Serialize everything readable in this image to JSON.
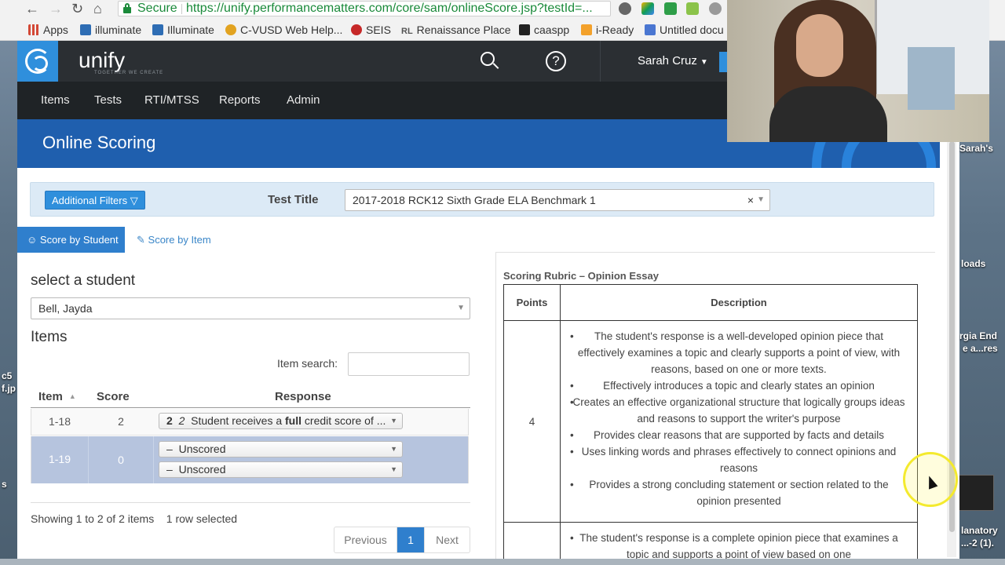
{
  "browser": {
    "secure_label": "Secure",
    "url": "https://unify.performancematters.com/core/sam/onlineScore.jsp?testId=...",
    "bookmarks": [
      {
        "label": "Apps",
        "color": "#d34836"
      },
      {
        "label": "illuminate",
        "color": "#2e6db4"
      },
      {
        "label": "Illuminate",
        "color": "#2e6db4"
      },
      {
        "label": "C-VUSD Web Help...",
        "color": "#e2a320"
      },
      {
        "label": "SEIS",
        "color": "#c62828"
      },
      {
        "label": "Renaissance Place",
        "color": "#555555"
      },
      {
        "label": "caaspp",
        "color": "#222222"
      },
      {
        "label": "i-Ready",
        "color": "#f3a12b"
      },
      {
        "label": "Untitled docu",
        "color": "#4a76d1"
      }
    ],
    "bookmark_prefix_rl": "RL"
  },
  "header": {
    "brand": "unify",
    "brand_tag": "TOGETHER WE CREATE",
    "user_name": "Sarah Cruz"
  },
  "nav": {
    "items": [
      "Items",
      "Tests",
      "RTI/MTSS",
      "Reports",
      "Admin"
    ]
  },
  "page_title": "Online Scoring",
  "filters": {
    "additional_filters_label": "Additional Filters",
    "test_title_label": "Test Title",
    "test_title_value": "2017-2018 RCK12 Sixth Grade ELA Benchmark 1",
    "clear_glyph": "×"
  },
  "tabs": {
    "score_by_student": "Score by Student",
    "score_by_item": "Score by Item"
  },
  "student": {
    "select_label": "select a student",
    "selected": "Bell, Jayda"
  },
  "items": {
    "heading": "Items",
    "search_label": "Item search:",
    "search_value": "",
    "columns": {
      "item": "Item",
      "score": "Score",
      "response": "Response"
    },
    "rows": [
      {
        "item": "1-18",
        "score": "2",
        "responses": [
          {
            "code": "2",
            "italic_code": "2",
            "text_before": "Student receives a ",
            "bold": "full",
            "text_after": " credit score of ..."
          }
        ],
        "selected": false
      },
      {
        "item": "1-19",
        "score": "0",
        "responses": [
          {
            "dash": "–",
            "text": "Unscored"
          },
          {
            "dash": "–",
            "text": "Unscored"
          }
        ],
        "selected": true
      }
    ],
    "showing": "Showing 1 to 2 of 2 items",
    "row_selected": "1 row selected",
    "pager": {
      "previous": "Previous",
      "current": "1",
      "next": "Next"
    }
  },
  "rubric": {
    "title": "Scoring Rubric – Opinion Essay",
    "col_points": "Points",
    "col_description": "Description",
    "rows": [
      {
        "points": "4",
        "bullets": [
          "The student's response is a well-developed opinion piece that effectively examines a topic and clearly supports a point of view, with reasons, based on one or more texts.",
          "Effectively introduces a topic and clearly states an opinion",
          "Creates an effective organizational structure that logically groups ideas and reasons to support the writer's purpose",
          "Provides clear reasons that are supported by facts and details",
          "Uses linking words and phrases effectively to connect opinions and reasons",
          "Provides a strong concluding statement or section related to the opinion presented"
        ]
      },
      {
        "points": "",
        "bullets": [
          "The student's response is a complete opinion piece that examines a topic and supports a point of view based on one"
        ]
      }
    ]
  },
  "desktop": {
    "labels": [
      "Sarah's",
      "loads",
      "rgia End",
      "e a...res",
      "c5",
      "f.jp",
      "s",
      "lanatory",
      "...-2 (1)."
    ]
  },
  "colors": {
    "brand_blue": "#2f8fdc",
    "title_band": "#1f5fae",
    "selected_row": "#b6c4de",
    "secure_green": "#1a8a3a"
  }
}
